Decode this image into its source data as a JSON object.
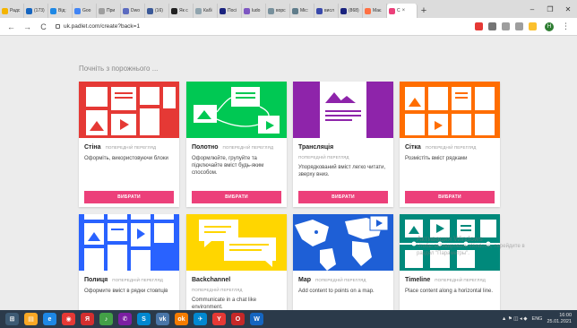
{
  "browser": {
    "tabs": [
      {
        "label": "Радс",
        "color": "#f4b400"
      },
      {
        "label": "(173)",
        "color": "#1565c0"
      },
      {
        "label": "Від:",
        "color": "#1e88e5"
      },
      {
        "label": "Goo",
        "color": "#4285f4"
      },
      {
        "label": "При",
        "color": "#9e9e9e"
      },
      {
        "label": "Dwo",
        "color": "#5c6bc0"
      },
      {
        "label": "(16)",
        "color": "#3b5998"
      },
      {
        "label": "Як с",
        "color": "#212121"
      },
      {
        "label": "Кабі",
        "color": "#90a4ae"
      },
      {
        "label": "Посі",
        "color": "#1a237e"
      },
      {
        "label": "ludo",
        "color": "#7e57c2"
      },
      {
        "label": "ворс",
        "color": "#78909c"
      },
      {
        "label": "Міс:",
        "color": "#607d8b"
      },
      {
        "label": "висл",
        "color": "#3949ab"
      },
      {
        "label": "(868)",
        "color": "#1a237e"
      },
      {
        "label": "Має",
        "color": "#ff7043"
      }
    ],
    "active_tab": {
      "label": "С",
      "close": "×",
      "color": "#ec407a"
    },
    "new_tab": "+",
    "window_controls": {
      "minimize": "–",
      "maximize": "❐",
      "close": "✕"
    },
    "back": "←",
    "forward": "→",
    "reload": "C",
    "url": "uk.padlet.com/create?back=1",
    "extensions": [
      {
        "name": "extension-icon",
        "color": "#e53935"
      },
      {
        "name": "settings-icon",
        "color": "#757575"
      },
      {
        "name": "translate-icon",
        "color": "#9e9e9e"
      },
      {
        "name": "star-icon",
        "color": "#9e9e9e"
      },
      {
        "name": "folder-icon",
        "color": "#fbc02d"
      }
    ],
    "profile_initial": "Н"
  },
  "page": {
    "section_title": "Почніть з порожнього ...",
    "preview_label": "ПОПЕРЕДНІЙ ПЕРЕГЛЯД",
    "choose_label": "ВИБРАТИ",
    "cards": [
      {
        "name": "Стіна",
        "desc": "Оформіть, використовуючи блоки",
        "color": "#e53935"
      },
      {
        "name": "Полотно",
        "desc": "Оформлюйте, групуйте та підключайте вміст будь-яким способом.",
        "color": "#00c853"
      },
      {
        "name": "Трансляція",
        "desc": "Упорядкований вміст легко читати, зверху вниз.",
        "color": "#8e24aa"
      },
      {
        "name": "Сітка",
        "desc": "Розмістіть вміст рядками",
        "color": "#ff6d00"
      },
      {
        "name": "Полиця",
        "desc": "Оформите вміст в рядки стовпців",
        "color": "#2962ff"
      },
      {
        "name": "Backchannel",
        "desc": "Communicate in a chat like environment.",
        "color": "#ffd600"
      },
      {
        "name": "Map",
        "desc": "Add content to points on a map.",
        "color": "#1e5fd6"
      },
      {
        "name": "Timeline",
        "desc": "Place content along a horizontal line.",
        "color": "#00897b"
      }
    ]
  },
  "watermark": {
    "title": "Активация Windows",
    "line1": "Чтобы активировать Windows, перейдите в",
    "line2": "раздел \"Параметры\"."
  },
  "taskbar": {
    "apps": [
      {
        "name": "start-icon",
        "label": "⊞",
        "color": "#3d5a73"
      },
      {
        "name": "explorer-icon",
        "label": "▤",
        "color": "#f9a825"
      },
      {
        "name": "ie-icon",
        "label": "e",
        "color": "#1e88e5"
      },
      {
        "name": "chrome-icon",
        "label": "◉",
        "color": "#e53935"
      },
      {
        "name": "yandex-icon",
        "label": "Я",
        "color": "#d32f2f"
      },
      {
        "name": "media-icon",
        "label": "♪",
        "color": "#43a047"
      },
      {
        "name": "viber-icon",
        "label": "✆",
        "color": "#7b1fa2"
      },
      {
        "name": "skype-icon",
        "label": "S",
        "color": "#0288d1"
      },
      {
        "name": "vk-icon",
        "label": "vk",
        "color": "#4a76a8"
      },
      {
        "name": "ok-icon",
        "label": "ok",
        "color": "#f57c00"
      },
      {
        "name": "telegram-icon",
        "label": "✈",
        "color": "#0288d1"
      },
      {
        "name": "yandex-browser-icon",
        "label": "Y",
        "color": "#e53935"
      },
      {
        "name": "opera-icon",
        "label": "O",
        "color": "#c62828"
      },
      {
        "name": "word-icon",
        "label": "W",
        "color": "#1565c0"
      }
    ],
    "tray": "▲ ⚑ ◫ ◂ ◆",
    "lang": "ENG",
    "time": "16:00",
    "date": "25.01.2021"
  }
}
